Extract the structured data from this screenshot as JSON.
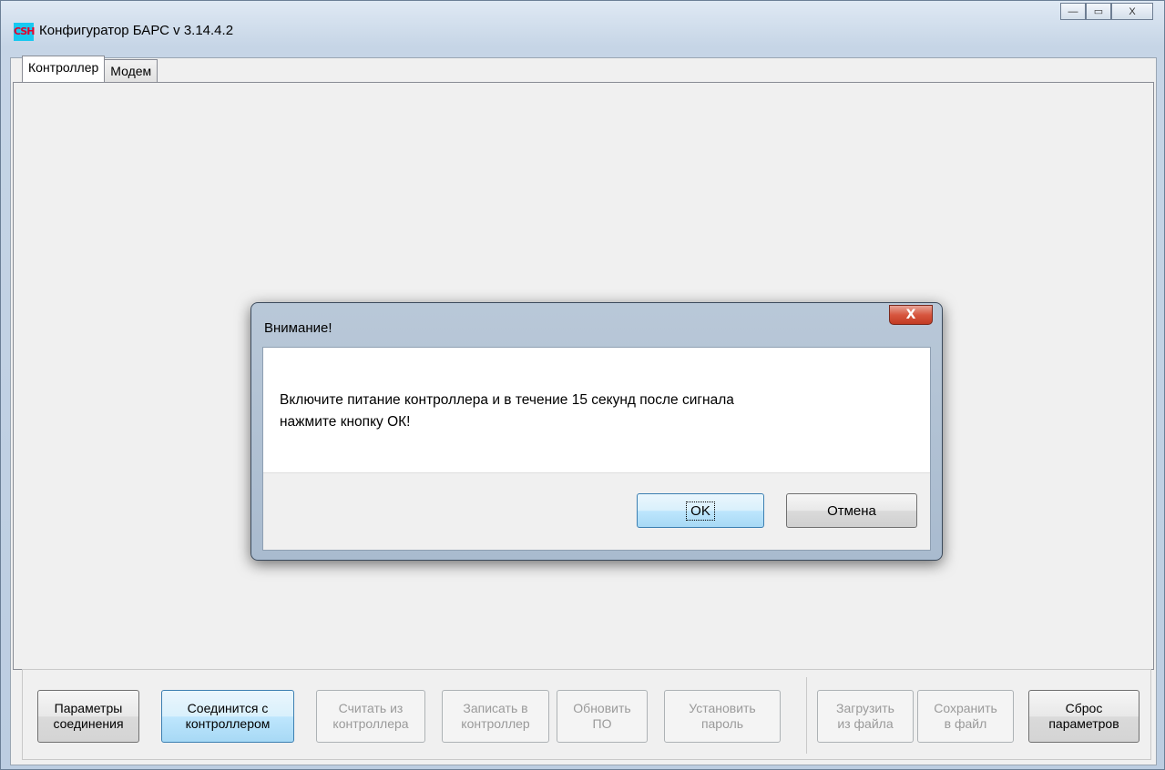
{
  "window": {
    "title": "Конфигуратор БАРС v 3.14.4.2",
    "icon_text": "CSH",
    "controls": {
      "minimize": "—",
      "maximize": "▭",
      "close": "X"
    }
  },
  "tabs": [
    {
      "label": "Контроллер",
      "active": true
    },
    {
      "label": "Модем",
      "active": false
    }
  ],
  "toolbar": {
    "buttons": [
      {
        "label": "Параметры\nсоединения",
        "enabled": true
      },
      {
        "label": "Соединится с\nконтроллером",
        "enabled": true,
        "focused": true
      },
      {
        "label": "Считать из\nконтроллера",
        "enabled": false
      },
      {
        "label": "Записать в\nконтроллер",
        "enabled": false
      },
      {
        "label": "Обновить\nПО",
        "enabled": false
      },
      {
        "label": "Установить\nпароль",
        "enabled": false
      },
      {
        "label": "Загрузить\nиз файла",
        "enabled": false
      },
      {
        "label": "Сохранить\nв файл",
        "enabled": false
      },
      {
        "label": "Сброс\nпараметров",
        "enabled": true
      }
    ]
  },
  "dialog": {
    "title": "Внимание!",
    "close_label": "X",
    "message": "Включите питание контроллера и в течение 15 секунд после сигнала\nнажмите кнопку ОК!",
    "ok_label": "OK",
    "cancel_label": "Отмена"
  },
  "colors": {
    "accent_focus": "#3c7fb1",
    "close_button": "#c23b23",
    "window_frame": "#c6d5e6"
  }
}
